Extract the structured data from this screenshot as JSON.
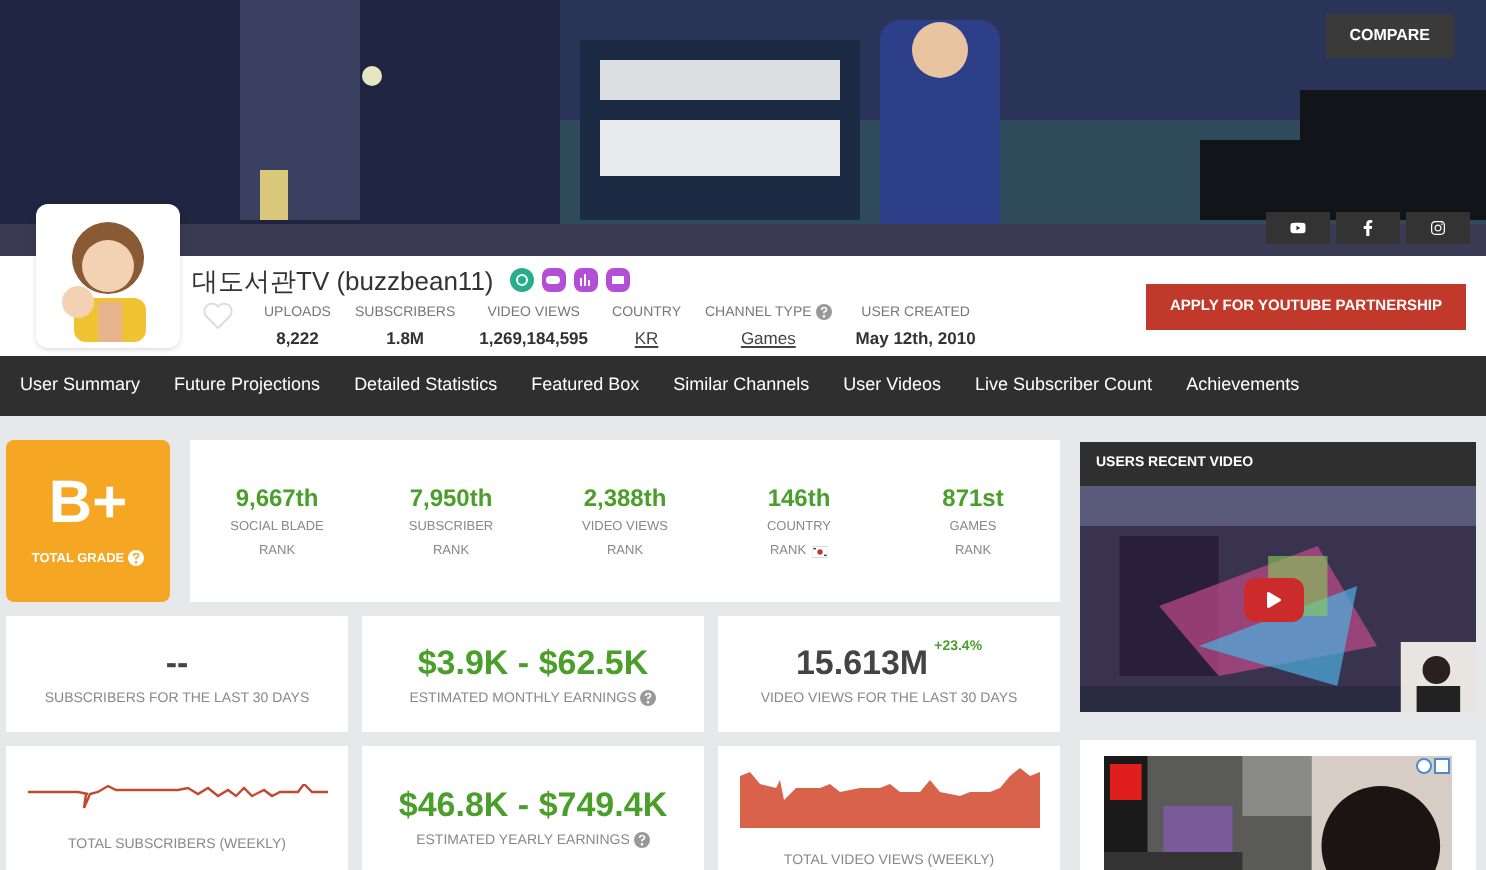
{
  "header": {
    "compare_button": "COMPARE",
    "channel_name": "대도서관TV (buzzbean11)",
    "stats": [
      {
        "label": "UPLOADS",
        "value": "8,222",
        "link": false,
        "help": false
      },
      {
        "label": "SUBSCRIBERS",
        "value": "1.8M",
        "link": false,
        "help": false
      },
      {
        "label": "VIDEO VIEWS",
        "value": "1,269,184,595",
        "link": false,
        "help": false
      },
      {
        "label": "COUNTRY",
        "value": "KR",
        "link": true,
        "help": false
      },
      {
        "label": "CHANNEL TYPE",
        "value": "Games",
        "link": true,
        "help": true
      },
      {
        "label": "USER CREATED",
        "value": "May 12th, 2010",
        "link": false,
        "help": false
      }
    ],
    "partner_button": "APPLY FOR YOUTUBE PARTNERSHIP"
  },
  "nav": [
    "User Summary",
    "Future Projections",
    "Detailed Statistics",
    "Featured Box",
    "Similar Channels",
    "User Videos",
    "Live Subscriber Count",
    "Achievements"
  ],
  "grade": {
    "value": "B+",
    "label": "TOTAL GRADE"
  },
  "ranks": [
    {
      "value": "9,667th",
      "label1": "SOCIAL BLADE",
      "label2": "RANK",
      "flag": false
    },
    {
      "value": "7,950th",
      "label1": "SUBSCRIBER",
      "label2": "RANK",
      "flag": false
    },
    {
      "value": "2,388th",
      "label1": "VIDEO VIEWS",
      "label2": "RANK",
      "flag": false
    },
    {
      "value": "146th",
      "label1": "COUNTRY",
      "label2": "RANK",
      "flag": true
    },
    {
      "value": "871st",
      "label1": "GAMES",
      "label2": "RANK",
      "flag": false
    }
  ],
  "cards": [
    {
      "kind": "stat",
      "value": "--",
      "label": "SUBSCRIBERS FOR THE LAST 30 DAYS",
      "green": false,
      "help": false
    },
    {
      "kind": "stat",
      "value": "$3.9K - $62.5K",
      "label": "ESTIMATED MONTHLY EARNINGS",
      "green": true,
      "help": true
    },
    {
      "kind": "stat",
      "value": "15.613M",
      "change": "+23.4%",
      "label": "VIDEO VIEWS FOR THE LAST 30 DAYS",
      "green": false,
      "help": false
    },
    {
      "kind": "line",
      "label": "TOTAL SUBSCRIBERS (WEEKLY)"
    },
    {
      "kind": "stat",
      "value": "$46.8K - $749.4K",
      "label": "ESTIMATED YEARLY EARNINGS",
      "green": true,
      "help": true
    },
    {
      "kind": "area",
      "label": "TOTAL VIDEO VIEWS (WEEKLY)"
    }
  ],
  "recent_video": {
    "title": "USERS RECENT VIDEO"
  }
}
